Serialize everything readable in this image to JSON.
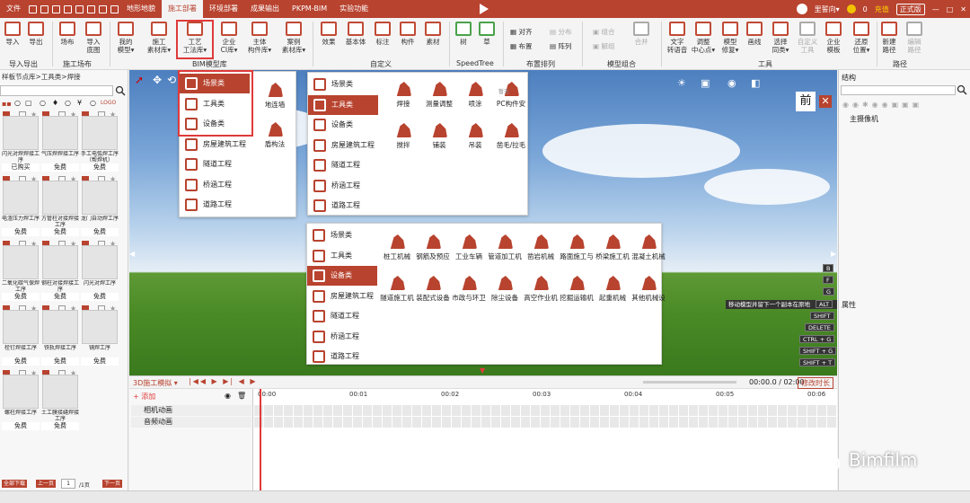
{
  "titlebar": {
    "file": "文件",
    "tabs": [
      "地形地貌",
      "施工部署",
      "环境部署",
      "成果输出",
      "PKPM-BIM",
      "实验功能"
    ],
    "active_tab": "施工部署",
    "user": "里誓向▾",
    "coins": "0",
    "recharge": "充值",
    "edition": "正式版"
  },
  "ribbon": {
    "import": "导入",
    "export": "导出",
    "group_io": "导入导出",
    "site_lib": "场布",
    "import_base": "导入\n底图",
    "group_site": "施工场布",
    "my_model": "我的\n模型▾",
    "con_lib": "施工\n素材库▾",
    "process_lib": "工艺\n工法库▾",
    "ci_lib": "企业\nCI库▾",
    "main_lib": "主体\n构件库▾",
    "case_lib": "案例\n素材库▾",
    "group_bim": "BIM模型库",
    "effect": "效果",
    "basic": "基本体",
    "mark": "标注",
    "component": "构件",
    "material": "素材",
    "group_custom": "自定义",
    "tree": "树",
    "grass": "草",
    "group_tree": "SpeedTree",
    "align": "对齐",
    "layout": "布置",
    "distribute": "分布",
    "array": "阵列",
    "group_arrange": "布置排列",
    "combine": "组合",
    "split": "解组",
    "merge": "合并",
    "group_combo": "模型组合",
    "text_voice": "文字\n转语音",
    "adjust_center": "调整\n中心点▾",
    "model_fix": "模型\n修复▾",
    "draw_line": "画线",
    "select_similar": "选择\n同类▾",
    "custom_tool": "自定义\n工具",
    "company_tpl": "企业\n模板",
    "restore_pos": "还原\n位置▾",
    "group_tools": "工具",
    "new_path": "新建\n路径",
    "edit_path": "编辑\n路径",
    "group_path": "路径"
  },
  "left": {
    "breadcrumb": "样板节点库>工具类>焊接",
    "filter_logo": "LOGO",
    "items": [
      {
        "label": "闪光对焊焊接工序",
        "price": "已购买"
      },
      {
        "label": "气压焊焊接工序",
        "price": "免费"
      },
      {
        "label": "手工电弧焊工序（帮焊机）",
        "price": "免费"
      },
      {
        "label": "电渣压力焊工序",
        "price": "免费"
      },
      {
        "label": "方管柱对接焊接工序",
        "price": "免费"
      },
      {
        "label": "龙门自动焊工序",
        "price": "免费"
      },
      {
        "label": "二氧化碳气保焊工序",
        "price": "免费"
      },
      {
        "label": "钢柱对接焊接工序",
        "price": "免费"
      },
      {
        "label": "闪光对焊工序",
        "price": "免费"
      },
      {
        "label": "栓钉焊接工序",
        "price": "免费"
      },
      {
        "label": "铁轨焊接工序",
        "price": "免费"
      },
      {
        "label": "铺焊工序",
        "price": "免费"
      },
      {
        "label": "螺柱焊接工序",
        "price": "免费"
      },
      {
        "label": "土工膜接缝焊接工序",
        "price": "免费"
      }
    ],
    "pager": {
      "all": "全部下载",
      "prev": "上一页",
      "page": "1",
      "total": "/1页",
      "next": "下一页"
    }
  },
  "menu_bim": {
    "items": [
      "场景类",
      "工具类",
      "设备类",
      "房屋建筑工程",
      "隧道工程",
      "桥涵工程",
      "道路工程"
    ],
    "grid": [
      "地连墙",
      "盾构法"
    ]
  },
  "menu_tool": {
    "items": [
      "场景类",
      "工具类",
      "设备类",
      "房屋建筑工程",
      "隧道工程",
      "桥涵工程",
      "道路工程"
    ],
    "grid": [
      "焊接",
      "测量调整",
      "喷涂",
      "PC构件安",
      "搅拌",
      "铺装",
      "吊装",
      "凿毛/拉毛"
    ],
    "tag": "暂无"
  },
  "menu_equip": {
    "items": [
      "场景类",
      "工具类",
      "设备类",
      "房屋建筑工程",
      "隧道工程",
      "桥涵工程",
      "道路工程"
    ],
    "grid": [
      "桩工机械",
      "钢筋及预应",
      "工业车辆",
      "管道加工机",
      "凿岩机械",
      "路面施工与",
      "桥梁施工机",
      "混凝土机械",
      "隧道施工机",
      "装配式设备",
      "市政与环卫",
      "除尘设备",
      "高空作业机",
      "挖掘运输机",
      "起重机械",
      "其他机械设"
    ]
  },
  "viewport": {
    "front": "前",
    "close": "✕",
    "tooltip": "移动模型并留下一个副本在原地",
    "keys": [
      "B",
      "F",
      "G",
      "ALT",
      "SHIFT",
      "DELETE",
      "CTRL + G",
      "SHIFT + G",
      "SHIFT + T"
    ]
  },
  "timeline": {
    "mode": "3D施工模拟 ▾",
    "add": "添加",
    "time": "00:00.0",
    "total": "02:00",
    "edit": "修改时长",
    "ticks": [
      "00:00",
      "00:01",
      "00:02",
      "00:03",
      "00:04",
      "00:05",
      "00:06"
    ],
    "tracks": [
      "相机动画",
      "音频动画"
    ]
  },
  "right": {
    "structure": "结构",
    "camera": "主摄像机",
    "props": "属性"
  },
  "watermark": "Bimfilm"
}
